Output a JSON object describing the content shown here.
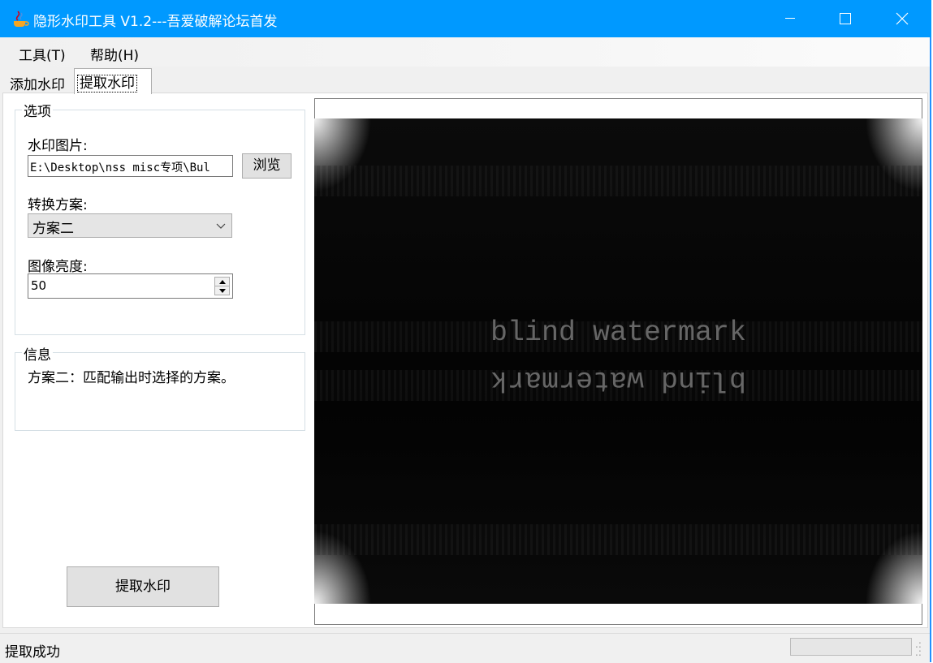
{
  "window": {
    "title": "隐形水印工具 V1.2---吾爱破解论坛首发",
    "icon": "java-cup-icon"
  },
  "menu": {
    "tools": "工具(T)",
    "help": "帮助(H)"
  },
  "tabs": [
    {
      "label": "添加水印",
      "active": false
    },
    {
      "label": "提取水印",
      "active": true
    }
  ],
  "options": {
    "group_label": "选项",
    "watermark_image_label": "水印图片:",
    "watermark_image_path": "E:\\Desktop\\nss misc专项\\Bul",
    "browse_label": "浏览",
    "scheme_label": "转换方案:",
    "scheme_value": "方案二",
    "brightness_label": "图像亮度:",
    "brightness_value": "50"
  },
  "info": {
    "group_label": "信息",
    "text": "方案二：匹配输出时选择的方案。"
  },
  "actions": {
    "extract_label": "提取水印"
  },
  "preview": {
    "watermark_text": "blind watermark"
  },
  "status": {
    "text": "提取成功"
  },
  "colors": {
    "titlebar": "#0099ff",
    "window_bg": "#f0f0f0",
    "button_bg": "#e1e1e1"
  }
}
